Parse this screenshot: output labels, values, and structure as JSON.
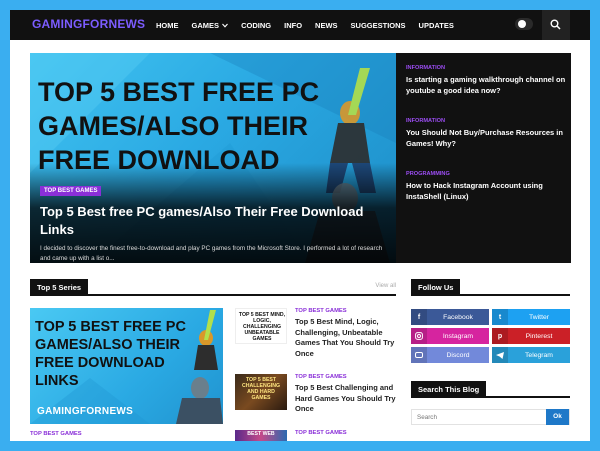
{
  "site": {
    "logo": "GAMINGFORNEWS"
  },
  "nav": {
    "items": [
      {
        "label": "HOME"
      },
      {
        "label": "GAMES"
      },
      {
        "label": "CODING"
      },
      {
        "label": "INFO"
      },
      {
        "label": "NEWS"
      },
      {
        "label": "SUGGESTIONS"
      },
      {
        "label": "UPDATES"
      }
    ],
    "games_dropdown_icon": "chevron-down-icon",
    "theme_toggle_icon": "moon-toggle-icon",
    "search_icon": "search-icon"
  },
  "hero": {
    "image_text": "TOP 5 BEST FREE PC GAMES/ALSO THEIR FREE DOWNLOAD",
    "tag": "TOP BEST GAMES",
    "title": "Top 5 Best free PC games/Also Their Free Download Links",
    "excerpt": "I decided to discover the finest free-to-download and play PC games from the Microsoft Store. I performed a lot of research and came up with a list o..."
  },
  "hero_side": [
    {
      "category": "INFORMATION",
      "title": "Is starting a gaming walkthrough channel on youtube a good idea now?"
    },
    {
      "category": "INFORMATION",
      "title": "You Should Not Buy/Purchase Resources in Games! Why?"
    },
    {
      "category": "PROGRAMMING",
      "title": "How to Hack Instagram Account using InstaShell (Linux)"
    }
  ],
  "top5": {
    "heading": "Top 5 Series",
    "view_all": "View all",
    "featured": {
      "image_text": "TOP 5 BEST FREE PC GAMES/ALSO THEIR FREE DOWNLOAD LINKS",
      "brand": "GAMINGFORNEWS",
      "category": "TOP BEST GAMES"
    },
    "posts": [
      {
        "thumb_text": "Top 5 Best Mind, Logic, Challenging Unbeatable Games",
        "category": "TOP BEST GAMES",
        "title": "Top 5 Best Mind, Logic, Challenging, Unbeatable Games That You Should Try Once"
      },
      {
        "thumb_text": "TOP 5 BEST CHALLENGING AND HARD GAMES",
        "category": "TOP BEST GAMES",
        "title": "Top 5 Best Challenging and Hard Games You Should Try Once"
      },
      {
        "thumb_text": "BEST WEB",
        "category": "TOP BEST GAMES",
        "title": ""
      }
    ]
  },
  "follow": {
    "heading": "Follow Us",
    "links": [
      {
        "label": "Facebook",
        "icon": "facebook-icon",
        "color": "#3b5998"
      },
      {
        "label": "Twitter",
        "icon": "twitter-icon",
        "color": "#1da1f2"
      },
      {
        "label": "Instagram",
        "icon": "instagram-icon",
        "color": "#d6249f"
      },
      {
        "label": "Pinterest",
        "icon": "pinterest-icon",
        "color": "#cb2027"
      },
      {
        "label": "Discord",
        "icon": "discord-icon",
        "color": "#7289da"
      },
      {
        "label": "Telegram",
        "icon": "telegram-icon",
        "color": "#2aa1da"
      }
    ]
  },
  "search_blog": {
    "heading": "Search This Blog",
    "placeholder": "Search",
    "button": "Ok"
  },
  "colors": {
    "page_border": "#3aaef0",
    "nav_bg": "#111111",
    "logo": "#7c5cff",
    "accent_purple": "#8a2fd8",
    "hero_sky": "#2aa9e3"
  }
}
